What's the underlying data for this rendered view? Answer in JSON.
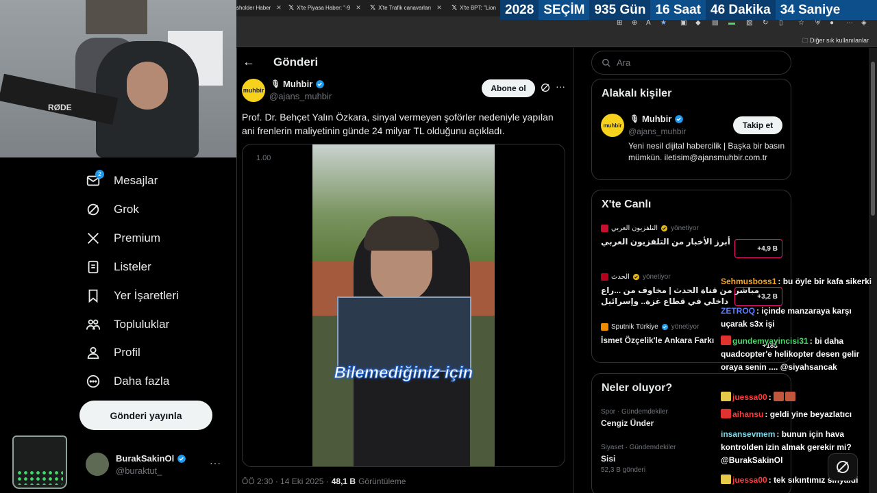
{
  "browser": {
    "tabs": [
      {
        "label": "sholder Haber"
      },
      {
        "label": "X'te Piyasa Haber: \"-9"
      },
      {
        "label": "X'te Trafik canavarları"
      },
      {
        "label": "X'te BPT: \"Lion"
      }
    ],
    "bookmarks_label": "Diğer sık kullanılanlar"
  },
  "countdown": {
    "year": "2028",
    "label": "SEÇİM",
    "days": "935 Gün",
    "hours": "16 Saat",
    "minutes": "46 Dakika",
    "seconds": "34 Saniye"
  },
  "webcam": {
    "mic_brand": "RØDE"
  },
  "nav": {
    "items": [
      {
        "label": "Mesajlar",
        "icon": "mail-icon",
        "badge": "2"
      },
      {
        "label": "Grok",
        "icon": "grok-icon"
      },
      {
        "label": "Premium",
        "icon": "x-logo-icon"
      },
      {
        "label": "Listeler",
        "icon": "list-icon"
      },
      {
        "label": "Yer İşaretleri",
        "icon": "bookmark-icon"
      },
      {
        "label": "Topluluklar",
        "icon": "communities-icon"
      },
      {
        "label": "Profil",
        "icon": "profile-icon"
      },
      {
        "label": "Daha fazla",
        "icon": "more-circle-icon"
      }
    ],
    "post_button": "Gönderi yayınla",
    "account": {
      "name": "BurakSakinOl",
      "handle": "@buraktut_"
    }
  },
  "main": {
    "header_title": "Gönderi",
    "tweet": {
      "avatar_text": "muhbir",
      "name": "Muhbir",
      "handle": "@ajans_muhbir",
      "follow_label": "Abone ol",
      "text": "Prof. Dr. Behçet Yalın Özkara, sinyal vermeyen şoförler nedeniyle yapılan ani frenlerin maliyetinin günde 24 milyar TL olduğunu açıkladı.",
      "playback_speed": "1.00",
      "video_caption": "Bilemediğiniz için",
      "time": "ÖÖ 2:30 · 14 Eki 2025 ·",
      "views": "48,1 B",
      "views_label": "Görüntüleme"
    }
  },
  "right": {
    "search_placeholder": "Ara",
    "related": {
      "title": "Alakalı kişiler",
      "avatar_text": "muhbir",
      "name": "Muhbir",
      "handle": "@ajans_muhbir",
      "bio": "Yeni nesil dijital habercilik | Başka bir basın mümkün. iletisim@ajansmuhbir.com.tr",
      "button": "Takip et"
    },
    "live": {
      "title": "X'te Canlı",
      "items": [
        {
          "source": "التلفزيون العربي",
          "role": "yönetiyor",
          "title": "أبرز الأخبار من التلفزيون العربي",
          "count": "+4,9 B",
          "color": "#c8102e"
        },
        {
          "source": "الحدث",
          "role": "yönetiyor",
          "title": "مباشر من قناة الحدث | مخاوف من ...راع داخلي في قطاع غزة.. وإسرائيل",
          "count": "+3,2 B",
          "color": "#b3001b"
        },
        {
          "source": "Sputnik Türkiye",
          "role": "yönetiyor",
          "title": "İsmet Özçelik'le Ankara Farkı",
          "count": "+183",
          "color": "#f08a00"
        }
      ]
    },
    "trends": {
      "title": "Neler oluyor?",
      "items": [
        {
          "category": "Spor · Gündemdekiler",
          "topic": "Cengiz Ünder",
          "count": ""
        },
        {
          "category": "Siyaset · Gündemdekiler",
          "topic": "Sisi",
          "count": "52,3 B gönderi"
        }
      ]
    }
  },
  "chat": [
    {
      "user": "Sehmusboss1",
      "color": "#f5a623",
      "text": "bu öyle bir kafa sikerki"
    },
    {
      "user": "ZETROQ",
      "color": "#5b7cff",
      "text": "içinde manzaraya karşı uçarak s3x işi"
    },
    {
      "user": "gundemyayincisi31",
      "color": "#4fd66b",
      "text": "bi daha quadcopter'e helikopter desen gelir oraya senin .... @siyahsancak"
    },
    {
      "user": "juessa00",
      "color": "#ff3b3b",
      "text": ""
    },
    {
      "user": "aihansu",
      "color": "#ff3b3b",
      "text": "geldi yine beyazlatıcı"
    },
    {
      "user": "insansevmem",
      "color": "#7fd8e8",
      "text": "bunun için hava kontrolden izin almak gerekir mi? @BurakSakinOl"
    },
    {
      "user": "juessa00",
      "color": "#ff3b3b",
      "text": "tek sıkıntımız sinyaldi"
    }
  ]
}
